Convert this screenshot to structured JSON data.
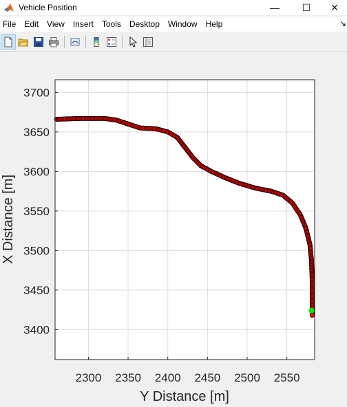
{
  "window": {
    "title": "Vehicle Position",
    "controls": {
      "minimize": "—",
      "maximize": "☐",
      "close": "✕"
    }
  },
  "menu": {
    "items": [
      "File",
      "Edit",
      "View",
      "Insert",
      "Tools",
      "Desktop",
      "Window",
      "Help"
    ],
    "overflow_arrow": "↘"
  },
  "toolbar": {
    "icons": [
      "new-figure-icon",
      "open-file-icon",
      "save-icon",
      "print-icon",
      "link-plot-icon",
      "colorbar-icon",
      "legend-icon",
      "pointer-icon",
      "property-inspector-icon"
    ]
  },
  "colors": {
    "marker_edge": "#000000",
    "marker_fill": "#ff0000",
    "end_marker": "#00ee00",
    "grid": "#dcdcdc",
    "axes_bg": "#ffffff",
    "figure_bg": "#f0f0f0"
  },
  "chart_data": {
    "type": "scatter",
    "title": "",
    "xlabel": "Y Distance [m]",
    "ylabel": "X Distance [m]",
    "xlim": [
      2258,
      2585
    ],
    "ylim": [
      3362,
      3716
    ],
    "xticks": [
      2300,
      2350,
      2400,
      2450,
      2500,
      2550
    ],
    "yticks": [
      3400,
      3450,
      3500,
      3550,
      3600,
      3650,
      3700
    ],
    "grid": true,
    "marker": "circle",
    "series": [
      {
        "name": "",
        "x": [
          2260,
          2290,
          2320,
          2335,
          2350,
          2365,
          2385,
          2400,
          2412,
          2422,
          2432,
          2442,
          2455,
          2470,
          2490,
          2510,
          2530,
          2545,
          2557,
          2567,
          2574,
          2579,
          2581,
          2582,
          2582,
          2582
        ],
        "y": [
          3666,
          3667,
          3667,
          3665,
          3660,
          3655,
          3654,
          3650,
          3643,
          3630,
          3617,
          3607,
          3600,
          3593,
          3585,
          3579,
          3575,
          3570,
          3560,
          3545,
          3528,
          3508,
          3488,
          3460,
          3440,
          3418
        ]
      },
      {
        "name": "",
        "x": [
          2581
        ],
        "y": [
          3424
        ]
      }
    ]
  }
}
